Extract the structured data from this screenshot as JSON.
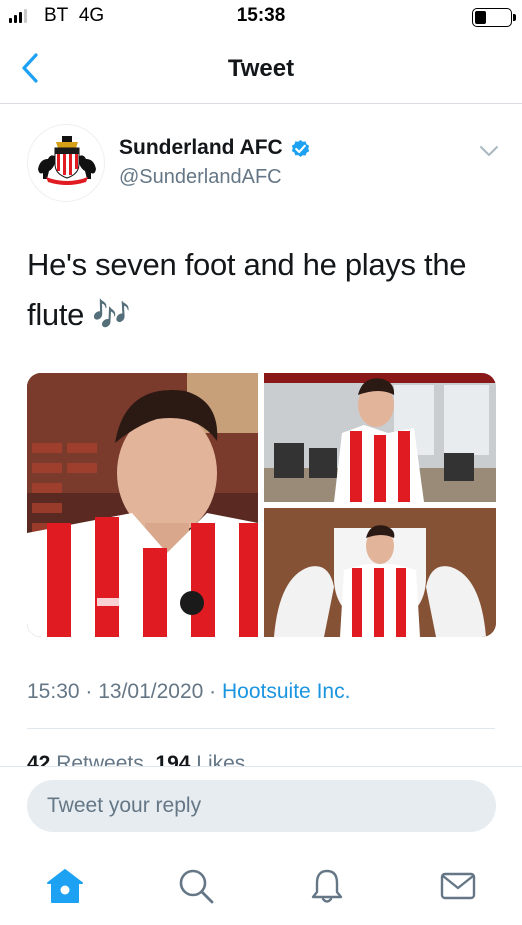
{
  "status_bar": {
    "carrier": "BT",
    "network": "4G",
    "time": "15:38",
    "signal_bars_filled": 3,
    "signal_bars_total": 4,
    "battery_level": 0.25
  },
  "nav": {
    "title": "Tweet",
    "back_icon": "chevron-left-icon"
  },
  "tweet": {
    "author": {
      "display_name": "Sunderland AFC",
      "handle": "@SunderlandAFC",
      "verified": true
    },
    "text": "He's seven foot and he plays the flute 🎶",
    "media": [
      {
        "description": "player-portrait"
      },
      {
        "description": "player-in-gym"
      },
      {
        "description": "player-with-crest"
      }
    ],
    "meta": {
      "time": "15:30",
      "date": "13/01/2020",
      "separator": " · ",
      "source": "Hootsuite Inc."
    },
    "counts": {
      "retweets": "42",
      "retweets_label": " Retweets",
      "likes": "194",
      "likes_label": " Likes"
    }
  },
  "reply": {
    "placeholder": "Tweet your reply"
  },
  "tabs": [
    {
      "name": "home",
      "icon": "home-icon",
      "active": true
    },
    {
      "name": "search",
      "icon": "search-icon",
      "active": false
    },
    {
      "name": "notifications",
      "icon": "bell-icon",
      "active": false
    },
    {
      "name": "messages",
      "icon": "mail-icon",
      "active": false
    }
  ],
  "colors": {
    "accent": "#1da1f2",
    "secondary_text": "#657786",
    "link": "#1b95e0",
    "club_red": "#e11b22"
  }
}
